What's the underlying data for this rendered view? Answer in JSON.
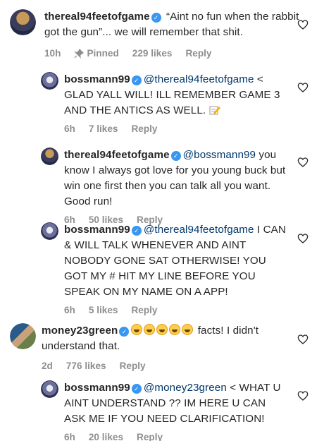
{
  "comments": [
    {
      "username": "thereal94feetofgame",
      "mention": "",
      "text": " “Aint no fun when the rabbit got the gun”... we will remember that shit.",
      "time": "10h",
      "pinned": "Pinned",
      "likes": "229 likes",
      "reply": "Reply"
    },
    {
      "username": "bossmann99",
      "mention": "@thereal94feetofgame",
      "text": " < GLAD YALL WILL! ILL  REMEMBER GAME 3 AND THE ANTICS AS WELL. ",
      "time": "6h",
      "likes": "7 likes",
      "reply": "Reply"
    },
    {
      "username": "thereal94feetofgame",
      "mention": "@bossmann99",
      "text": " you know I always got love for you young buck but win one first then you can talk all you want.  Good run!",
      "time": "6h",
      "likes": "50 likes",
      "reply": "Reply"
    },
    {
      "username": "bossmann99",
      "mention": "@thereal94feetofgame",
      "text": "  I CAN & WILL TALK WHENEVER AND AINT NOBODY GONE SAT OTHERWISE!  YOU GOT MY # HIT MY LINE BEFORE YOU SPEAK ON MY NAME ON A APP!",
      "time": "6h",
      "likes": "5 likes",
      "reply": "Reply"
    },
    {
      "username": "money23green",
      "mention": "",
      "text": " facts! I didn't understand that.",
      "time": "2d",
      "likes": "776 likes",
      "reply": "Reply"
    },
    {
      "username": "bossmann99",
      "mention": "@money23green",
      "text": " < WHAT U AINT UNDERSTAND ?? IM HERE U CAN ASK ME IF YOU NEED CLARIFICATION!",
      "time": "6h",
      "likes": "20 likes",
      "reply": "Reply"
    }
  ],
  "icons": {
    "verified": "verified-badge-icon",
    "heart": "heart-outline-icon",
    "pin": "pin-icon",
    "emoji": "rolling-laughing-emoji-icon",
    "pencil": "memo-pencil-emoji-icon"
  },
  "colors": {
    "verified": "#3897f0",
    "mention": "#00376b",
    "meta": "#8e8e8e",
    "text": "#262626"
  }
}
